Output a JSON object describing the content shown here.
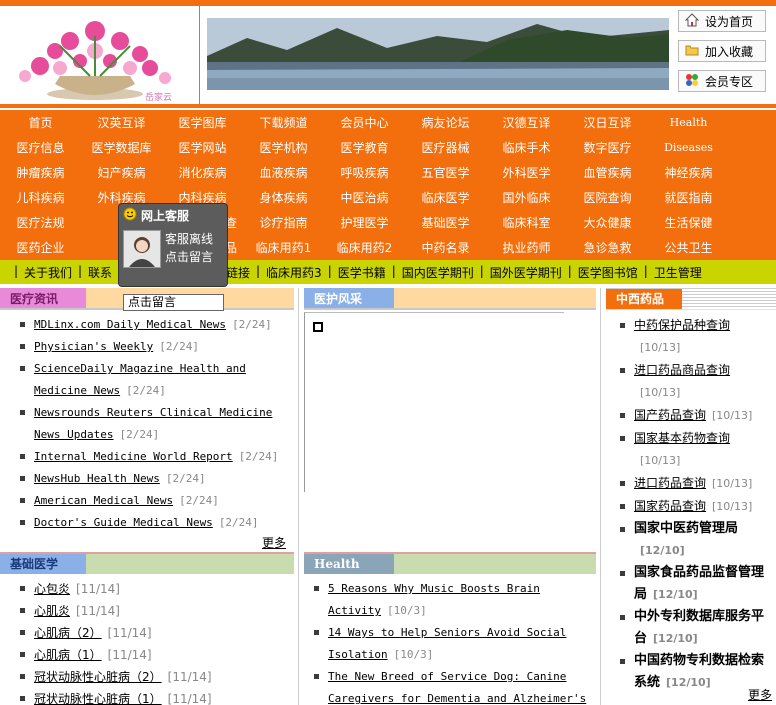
{
  "header": {
    "toplinks": [
      {
        "label": "设为首页",
        "icon": "home-icon"
      },
      {
        "label": "加入收藏",
        "icon": "folder-icon"
      },
      {
        "label": "会员专区",
        "icon": "members-icon"
      }
    ]
  },
  "nav": {
    "rows": [
      [
        "首页",
        "汉英互译",
        "医学图库",
        "下载频道",
        "会员中心",
        "病友论坛",
        "汉德互译",
        "汉日互译",
        "Health"
      ],
      [
        "医疗信息",
        "医学数据库",
        "医学网站",
        "医学机构",
        "医学教育",
        "医疗器械",
        "临床手术",
        "数字医疗",
        "Diseases"
      ],
      [
        "肿瘤疾病",
        "妇产疾病",
        "消化疾病",
        "血液疾病",
        "呼吸疾病",
        "五官医学",
        "外科医学",
        "血管疾病",
        "神经疾病"
      ],
      [
        "儿科疾病",
        "外科疾病",
        "内科疾病",
        "身体疾病",
        "中医治病",
        "临床医学",
        "国外临床",
        "医院查询",
        "就医指南"
      ],
      [
        "医疗法规",
        "",
        "",
        "诊疗指南",
        "护理医学",
        "基础医学",
        "临床科室",
        "大众健康",
        "生活保健"
      ],
      [
        "医药企业",
        "",
        "",
        "临床用药1",
        "临床用药2",
        "中药名录",
        "执业药师",
        "急诊急救",
        "公共卫生"
      ]
    ],
    "row5_partial": "查",
    "row6_partial": "品",
    "row3_col2_partial": "外科疾病"
  },
  "subnav": [
    "关于我们",
    "联系",
    "友情链接",
    "临床用药3",
    "医学书籍",
    "国内医学期刊",
    "国外医学期刊",
    "医学图书馆",
    "卫生管理"
  ],
  "customer_service": {
    "title": "网上客服",
    "status": "客服离线",
    "action": "点击留言",
    "message_input": "点击留言"
  },
  "panels": {
    "news": {
      "title": "医疗资讯",
      "items": [
        {
          "t": "MDLinx.com Daily Medical News",
          "d": "[2/24]"
        },
        {
          "t": "Physician's Weekly",
          "d": "[2/24]"
        },
        {
          "t": "ScienceDaily Magazine Health and Medicine News",
          "d": "[2/24]"
        },
        {
          "t": "Newsrounds Reuters Clinical Medicine News Updates",
          "d": "[2/24]"
        },
        {
          "t": "Internal Medicine World Report",
          "d": "[2/24]"
        },
        {
          "t": "NewsHub Health News",
          "d": "[2/24]"
        },
        {
          "t": "American Medical News",
          "d": "[2/24]"
        },
        {
          "t": "Doctor's Guide Medical News",
          "d": "[2/24]"
        }
      ],
      "more": "更多"
    },
    "nursing": {
      "title": "医护风采"
    },
    "drugs": {
      "title": "中西药品",
      "items": [
        {
          "t": "中药保护品种查询",
          "d": "[10/13]"
        },
        {
          "t": "进口药品商品查询",
          "d": "[10/13]"
        },
        {
          "t": "国产药品查询",
          "d": "[10/13]"
        },
        {
          "t": "国家基本药物查询",
          "d": "[10/13]"
        },
        {
          "t": "进口药品查询",
          "d": "[10/13]"
        },
        {
          "t": "国家药品查询",
          "d": "[10/13]"
        }
      ],
      "bold_items": [
        {
          "t": "国家中医药管理局",
          "d": "[12/10]"
        },
        {
          "t": "国家食品药品监督管理局",
          "d": "[12/10]"
        },
        {
          "t": "中外专利数据库服务平台",
          "d": "[12/10]"
        },
        {
          "t": "中国药物专利数据检索系统",
          "d": "[12/10]"
        }
      ],
      "more": "更多"
    },
    "basic": {
      "title": "基础医学",
      "items": [
        {
          "t": "心包炎",
          "d": "[11/14]"
        },
        {
          "t": "心肌炎",
          "d": "[11/14]"
        },
        {
          "t": "心肌病（2）",
          "d": "[11/14]"
        },
        {
          "t": "心肌病（1）",
          "d": "[11/14]"
        },
        {
          "t": "冠状动脉性心脏病（2）",
          "d": "[11/14]"
        },
        {
          "t": "冠状动脉性心脏病（1）",
          "d": "[11/14]"
        }
      ]
    },
    "health": {
      "title": "Health",
      "items": [
        {
          "t": "5 Reasons Why Music Boosts Brain Activity",
          "d": "[10/3]"
        },
        {
          "t": "14 Ways to Help Seniors Avoid Social Isolation",
          "d": "[10/3]"
        },
        {
          "t": "The New Breed of Service Dog: Canine Caregivers for Dementia and Alzheimer's",
          "d": ""
        }
      ]
    }
  },
  "colors": {
    "orange": "#f36f0e",
    "ybar": "#c9d400",
    "pink_tab": "#e98ad9",
    "blue_tab": "#8bb0e8"
  }
}
